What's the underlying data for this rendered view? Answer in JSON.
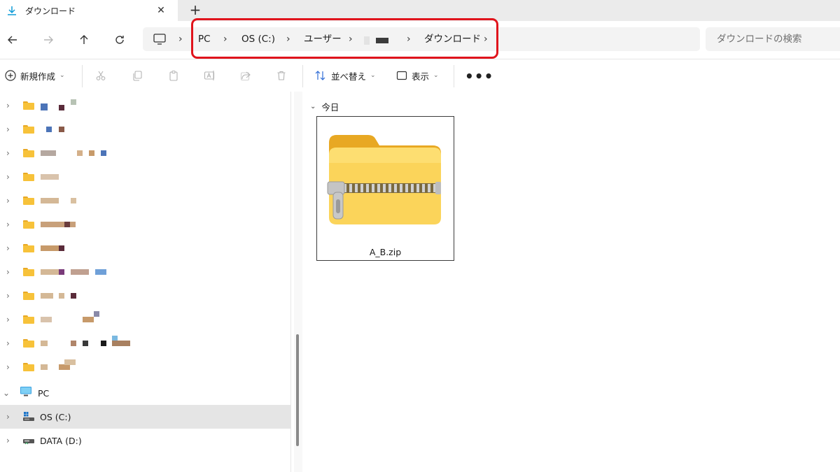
{
  "tab": {
    "title": "ダウンロード",
    "close_glyph": "✕",
    "new_tab_glyph": "+"
  },
  "nav": {
    "back_icon": "arrow-left-icon",
    "forward_icon": "arrow-right-icon",
    "up_icon": "arrow-up-icon",
    "refresh_icon": "refresh-icon"
  },
  "breadcrumb": {
    "items": [
      "PC",
      "OS (C:)",
      "ユーザー",
      "ダウンロード"
    ],
    "separator": "›"
  },
  "search": {
    "placeholder": "ダウンロードの検索"
  },
  "commands": {
    "new_label": "新規作成",
    "sort_label": "並べ替え",
    "view_label": "表示",
    "more_glyph": "•••"
  },
  "tree": {
    "pc_label": "PC",
    "drives": [
      {
        "label": "OS (C:)",
        "selected": true
      },
      {
        "label": "DATA (D:)",
        "selected": false
      }
    ]
  },
  "content": {
    "group_label": "今日",
    "files": [
      {
        "name": "A_B.zip"
      }
    ]
  },
  "colors": {
    "highlight": "#e0141c",
    "folder": "#f7c23a",
    "accent": "#0f9bd7"
  }
}
